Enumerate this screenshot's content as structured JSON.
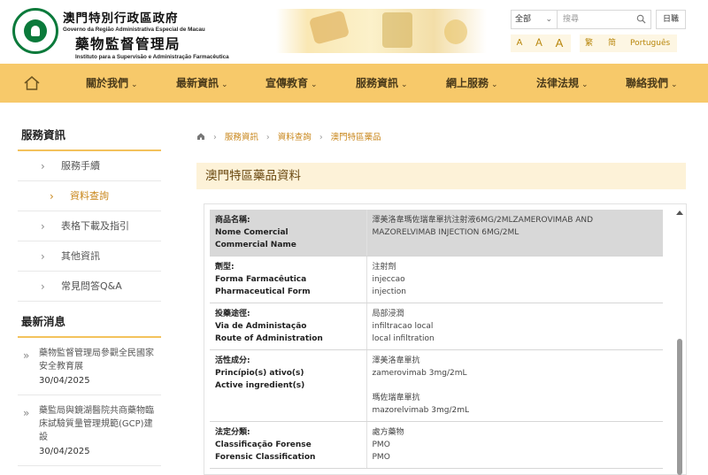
{
  "header": {
    "org_cn": "澳門特別行政區政府",
    "org_pt": "Governo da Região Administrativa Especial de Macau",
    "dept_cn": "藥物監督管理局",
    "dept_pt": "Instituto para a Supervisão e Administração Farmacêutica"
  },
  "search": {
    "scope": "全部",
    "placeholder": "搜尋"
  },
  "calendar_label": "日職",
  "font_sizes": [
    "A",
    "A",
    "A"
  ],
  "languages": [
    "繁",
    "简",
    "Português"
  ],
  "nav": {
    "items": [
      "關於我們",
      "最新資訊",
      "宣傳教育",
      "服務資訊",
      "網上服務",
      "法律法規",
      "聯絡我們"
    ]
  },
  "sidebar": {
    "title": "服務資訊",
    "items": [
      "服務手續",
      "資料查詢",
      "表格下載及指引",
      "其他資訊",
      "常見問答Q&A"
    ],
    "active_index": 1
  },
  "news": {
    "title": "最新消息",
    "items": [
      {
        "text": "藥物監督管理局參觀全民國家安全教育展",
        "date": "30/04/2025"
      },
      {
        "text": "藥監局與鏡湖醫院共商藥物臨床試驗質量管理規範(GCP)建設",
        "date": "30/04/2025"
      }
    ]
  },
  "breadcrumb": [
    "服務資訊",
    "資料查詢",
    "澳門特區藥品"
  ],
  "page_title": "澳門特區藥品資料",
  "table": {
    "rows": [
      {
        "label_cn": "商品名稱:",
        "label_pt": "Nome Comercial",
        "label_en": "Commercial Name",
        "values": [
          "澤美洛韋瑪佐瑞韋單抗注射液6MG/2MLZAMEROVIMAB AND MAZORELVIMAB INJECTION 6MG/2ML"
        ]
      },
      {
        "label_cn": "劑型:",
        "label_pt": "Forma Farmacêutica",
        "label_en": "Pharmaceutical Form",
        "values": [
          "注射劑",
          "injeccao",
          "injection"
        ]
      },
      {
        "label_cn": "投藥途徑:",
        "label_pt": "Via de Administação",
        "label_en": "Route of Administration",
        "values": [
          "局部浸潤",
          "infiltracao local",
          "local infiltration"
        ]
      },
      {
        "label_cn": "活性成分:",
        "label_pt": "Princípio(s) ativo(s)",
        "label_en": "Active ingredient(s)",
        "values": [
          "澤美洛韋單抗",
          "zamerovimab 3mg/2mL",
          "",
          "瑪佐瑞韋單抗",
          "mazorelvimab 3mg/2mL"
        ]
      },
      {
        "label_cn": "法定分類:",
        "label_pt": "Classificação Forense",
        "label_en": "Forensic Classification",
        "values": [
          "處方藥物",
          "PMO",
          "PMO"
        ]
      }
    ]
  },
  "colors": {
    "nav_bg": "#f7c96a",
    "accent": "#c8861a",
    "title_bar": "#fdf2d8",
    "logo_green": "#0b7a3b"
  }
}
